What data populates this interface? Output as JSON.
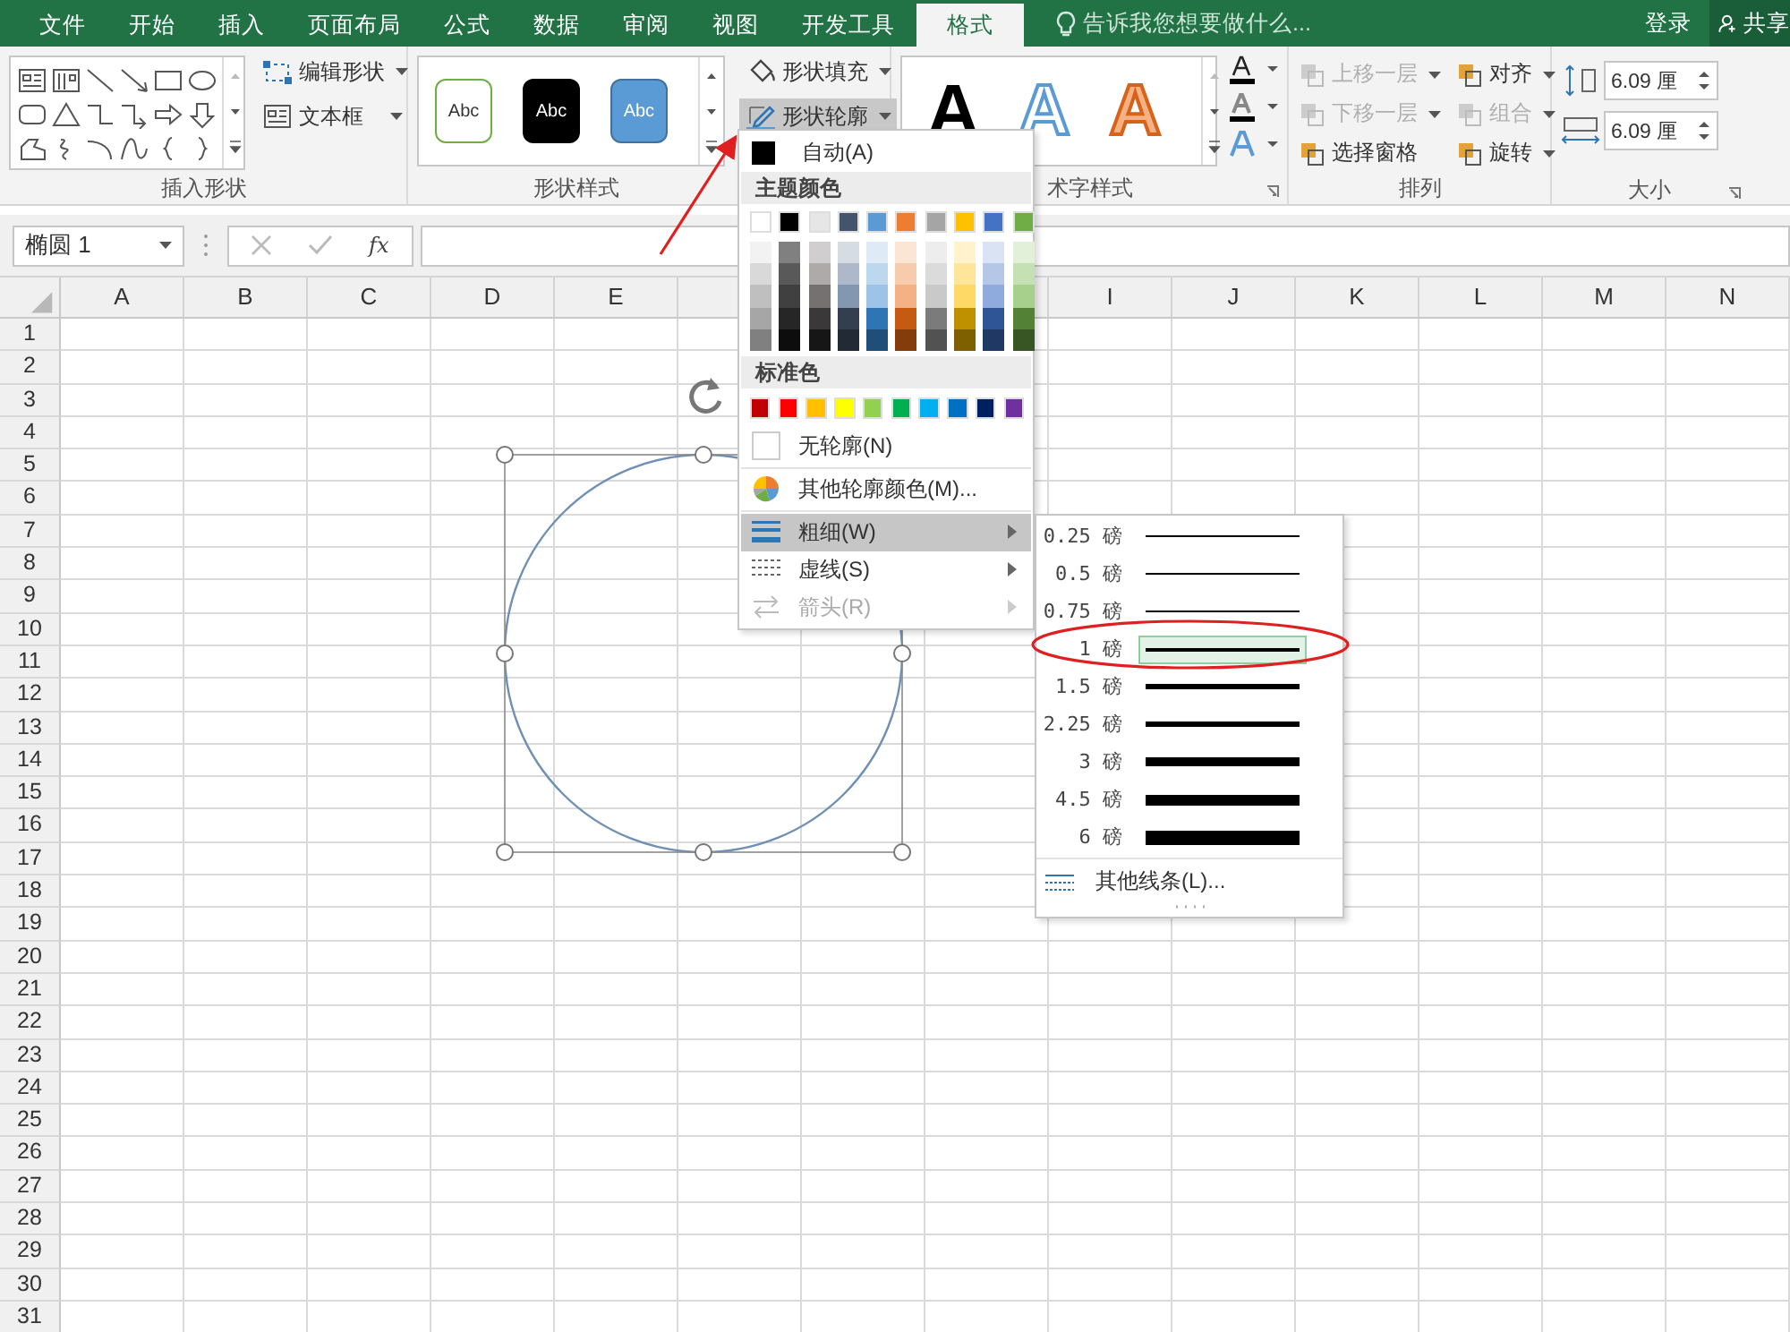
{
  "ribbon_tabs": [
    {
      "label": "文件",
      "selected": false
    },
    {
      "label": "开始",
      "selected": false
    },
    {
      "label": "插入",
      "selected": false
    },
    {
      "label": "页面布局",
      "selected": false
    },
    {
      "label": "公式",
      "selected": false
    },
    {
      "label": "数据",
      "selected": false
    },
    {
      "label": "审阅",
      "selected": false
    },
    {
      "label": "视图",
      "selected": false
    },
    {
      "label": "开发工具",
      "selected": false
    },
    {
      "label": "格式",
      "selected": true
    }
  ],
  "tell_me": {
    "placeholder": "告诉我您想要做什么..."
  },
  "account": {
    "sign_in": "登录",
    "share": "共享"
  },
  "insert_shapes": {
    "label": "插入形状",
    "edit_shape": "编辑形状",
    "text_box": "文本框"
  },
  "shape_styles": {
    "label": "形状样式",
    "presets": [
      {
        "text": "Abc",
        "kind": "outline"
      },
      {
        "text": "Abc",
        "kind": "dark"
      },
      {
        "text": "Abc",
        "kind": "blue"
      }
    ],
    "fill": "形状填充",
    "outline": {
      "label": "形状轮廓",
      "selected": true
    }
  },
  "wordart_styles": {
    "label": "术字样式",
    "presets": [
      {
        "text": "A",
        "kind": "black"
      },
      {
        "text": "A",
        "kind": "blue"
      },
      {
        "text": "A",
        "kind": "orange"
      }
    ]
  },
  "arrange": {
    "label": "排列",
    "items": [
      {
        "label": "上移一层",
        "disabled": true
      },
      {
        "label": "对齐",
        "disabled": false
      },
      {
        "label": "下移一层",
        "disabled": true
      },
      {
        "label": "组合",
        "disabled": true
      },
      {
        "label": "选择窗格",
        "disabled": false
      },
      {
        "label": "旋转",
        "disabled": false
      }
    ]
  },
  "size": {
    "label": "大小",
    "height": "6.09 厘",
    "width": "6.09 厘"
  },
  "formula_bar": {
    "name_box": "椭圆 1",
    "function_label": "fx"
  },
  "columns_left": [
    "A",
    "B",
    "C",
    "D",
    "E"
  ],
  "columns_right": [
    "I",
    "J",
    "K",
    "L",
    "M",
    "N"
  ],
  "rows": [
    "1",
    "2",
    "3",
    "4",
    "5",
    "6",
    "7",
    "8",
    "9",
    "10",
    "11",
    "12",
    "13",
    "14",
    "15",
    "16",
    "17",
    "18",
    "19",
    "20",
    "21",
    "22",
    "23",
    "24",
    "25",
    "26",
    "27",
    "28",
    "29",
    "30",
    "31"
  ],
  "outline_menu": {
    "automatic": {
      "label": "自动(A)",
      "color": "#000000"
    },
    "theme_heading": "主题颜色",
    "theme_colors": [
      {
        "color": "#ffffff",
        "shades": [
          {
            "color": "#f2f2f2"
          },
          {
            "color": "#d9d9d9"
          },
          {
            "color": "#bfbfbf"
          },
          {
            "color": "#a6a6a6"
          },
          {
            "color": "#808080"
          }
        ]
      },
      {
        "color": "#000000",
        "shades": [
          {
            "color": "#808080"
          },
          {
            "color": "#595959"
          },
          {
            "color": "#404040"
          },
          {
            "color": "#262626"
          },
          {
            "color": "#0d0d0d"
          }
        ]
      },
      {
        "color": "#e7e6e6",
        "shades": [
          {
            "color": "#d0cece"
          },
          {
            "color": "#aeaaaa"
          },
          {
            "color": "#757171"
          },
          {
            "color": "#3a3838"
          },
          {
            "color": "#171616"
          }
        ]
      },
      {
        "color": "#44546a",
        "shades": [
          {
            "color": "#d6dce4"
          },
          {
            "color": "#adb9ca"
          },
          {
            "color": "#8497b0"
          },
          {
            "color": "#333f4f"
          },
          {
            "color": "#222a35"
          }
        ]
      },
      {
        "color": "#5b9bd5",
        "shades": [
          {
            "color": "#deebf6"
          },
          {
            "color": "#bdd7ee"
          },
          {
            "color": "#9dc3e6"
          },
          {
            "color": "#2e75b5"
          },
          {
            "color": "#1f4e79"
          }
        ]
      },
      {
        "color": "#ed7d31",
        "shades": [
          {
            "color": "#fbe5d5"
          },
          {
            "color": "#f8cbad"
          },
          {
            "color": "#f4b183"
          },
          {
            "color": "#c55a11"
          },
          {
            "color": "#843c0b"
          }
        ]
      },
      {
        "color": "#a5a5a5",
        "shades": [
          {
            "color": "#ededed"
          },
          {
            "color": "#dbdbdb"
          },
          {
            "color": "#c9c9c9"
          },
          {
            "color": "#7b7b7b"
          },
          {
            "color": "#525252"
          }
        ]
      },
      {
        "color": "#ffc000",
        "shades": [
          {
            "color": "#fff2cc"
          },
          {
            "color": "#fee599"
          },
          {
            "color": "#ffd965"
          },
          {
            "color": "#bf9000"
          },
          {
            "color": "#7f6000"
          }
        ]
      },
      {
        "color": "#4472c4",
        "shades": [
          {
            "color": "#dae3f3"
          },
          {
            "color": "#b4c7e7"
          },
          {
            "color": "#8faadc"
          },
          {
            "color": "#2f5597"
          },
          {
            "color": "#203864"
          }
        ]
      },
      {
        "color": "#70ad47",
        "shades": [
          {
            "color": "#e2efd9"
          },
          {
            "color": "#c5e0b3"
          },
          {
            "color": "#a8d08d"
          },
          {
            "color": "#538135"
          },
          {
            "color": "#375623"
          }
        ]
      }
    ],
    "standard_heading": "标准色",
    "standard_colors": [
      {
        "color": "#c00000"
      },
      {
        "color": "#ff0000"
      },
      {
        "color": "#ffc000"
      },
      {
        "color": "#ffff00"
      },
      {
        "color": "#92d050"
      },
      {
        "color": "#00b050"
      },
      {
        "color": "#00b0f0"
      },
      {
        "color": "#0070c0"
      },
      {
        "color": "#002060"
      },
      {
        "color": "#7030a0"
      }
    ],
    "items": [
      {
        "label": "无轮廓(N)",
        "kind": "none",
        "selected": false,
        "disabled": false,
        "submenu": false
      },
      {
        "label": "其他轮廓颜色(M)...",
        "kind": "palette",
        "selected": false,
        "disabled": false,
        "submenu": false
      },
      {
        "label": "粗细(W)",
        "kind": "weight",
        "selected": true,
        "disabled": false,
        "submenu": true
      },
      {
        "label": "虚线(S)",
        "kind": "dash",
        "selected": false,
        "disabled": false,
        "submenu": true
      },
      {
        "label": "箭头(R)",
        "kind": "arrows",
        "selected": false,
        "disabled": true,
        "submenu": true
      }
    ]
  },
  "weight_submenu": {
    "items": [
      {
        "label": "0.25 磅",
        "kind": "w025",
        "selected": false
      },
      {
        "label": "0.5 磅",
        "kind": "w05",
        "selected": false
      },
      {
        "label": "0.75 磅",
        "kind": "w075",
        "selected": false
      },
      {
        "label": "1 磅",
        "kind": "w1",
        "selected": true
      },
      {
        "label": "1.5 磅",
        "kind": "w15",
        "selected": false
      },
      {
        "label": "2.25 磅",
        "kind": "w225",
        "selected": false
      },
      {
        "label": "3 磅",
        "kind": "w3",
        "selected": false
      },
      {
        "label": "4.5 磅",
        "kind": "w45",
        "selected": false
      },
      {
        "label": "6 磅",
        "kind": "w6",
        "selected": false
      }
    ],
    "more": "其他线条(L)..."
  }
}
